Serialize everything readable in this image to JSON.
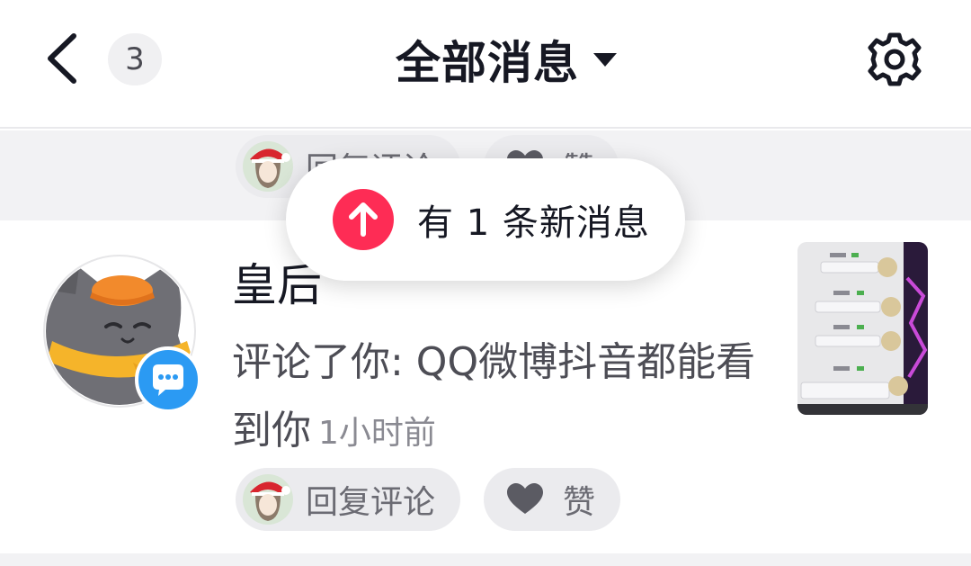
{
  "header": {
    "unread_count": "3",
    "title": "全部消息"
  },
  "previous_item": {
    "reply_label": "回复评论",
    "like_label": "赞"
  },
  "toast": {
    "text": "有 1 条新消息"
  },
  "message": {
    "username": "皇后",
    "comment": "评论了你: QQ微博抖音都能看到你",
    "time": "1小时前",
    "reply_label": "回复评论",
    "like_label": "赞"
  },
  "colors": {
    "accent": "#fe2c55",
    "badge_blue": "#2b9af3",
    "text_primary": "#161823",
    "text_secondary": "#8a8a92"
  },
  "icons": {
    "back": "chevron-left-icon",
    "settings": "gear-icon",
    "dropdown": "caret-down-icon",
    "toast": "arrow-up-circle-icon",
    "like": "heart-icon",
    "comment_badge": "chat-bubble-icon"
  }
}
